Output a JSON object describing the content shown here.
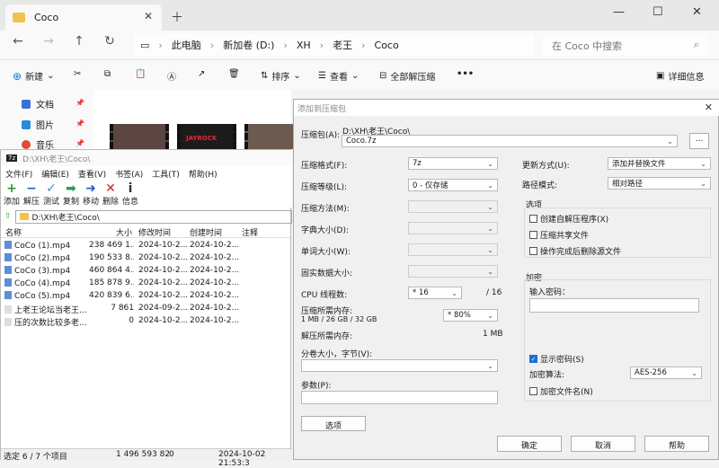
{
  "explorer": {
    "tab_title": "Coco",
    "breadcrumb": [
      "此电脑",
      "新加卷 (D:)",
      "XH",
      "老王",
      "Coco"
    ],
    "search_placeholder": "在 Coco 中搜索",
    "toolbar": {
      "new_label": "新建",
      "sort_label": "排序",
      "view_label": "查看",
      "extract_all_label": "全部解压缩",
      "more_label": "•••",
      "details_label": "详细信息"
    },
    "sidebar": [
      {
        "label": "文档",
        "color": "#3b6fd6"
      },
      {
        "label": "图片",
        "color": "#2a8bd8"
      },
      {
        "label": "音乐",
        "color": "#e24a3b"
      }
    ],
    "thumb_text": "JAYROCK"
  },
  "fm": {
    "title": "D:\\XH\\老王\\Coco\\",
    "menu": [
      "文件(F)",
      "编辑(E)",
      "查看(V)",
      "书签(A)",
      "工具(T)",
      "帮助(H)"
    ],
    "tools": [
      {
        "icon": "+",
        "label": "添加",
        "color": "#2e9a2e"
      },
      {
        "icon": "−",
        "label": "解压",
        "color": "#2a5bd6"
      },
      {
        "icon": "✓",
        "label": "测试",
        "color": "#2aa0b8"
      },
      {
        "icon": "➡",
        "label": "复制",
        "color": "#2e9a5a"
      },
      {
        "icon": "➜",
        "label": "移动",
        "color": "#2a5bd6"
      },
      {
        "icon": "✕",
        "label": "删除",
        "color": "#d62020"
      },
      {
        "icon": "i",
        "label": "信息",
        "color": "#333"
      }
    ],
    "path": "D:\\XH\\老王\\Coco\\",
    "columns": {
      "name": "名称",
      "size": "大小",
      "modified": "修改时间",
      "created": "创建时间",
      "comment": "注释"
    },
    "rows": [
      {
        "name": "CoCo (1).mp4",
        "size": "238 469 1...",
        "modified": "2024-10-2...",
        "created": "2024-10-2..."
      },
      {
        "name": "CoCo (2).mp4",
        "size": "190 533 8...",
        "modified": "2024-10-2...",
        "created": "2024-10-2..."
      },
      {
        "name": "CoCo (3).mp4",
        "size": "460 864 4...",
        "modified": "2024-10-2...",
        "created": "2024-10-2..."
      },
      {
        "name": "CoCo (4).mp4",
        "size": "185 878 9...",
        "modified": "2024-10-2...",
        "created": "2024-10-2..."
      },
      {
        "name": "CoCo (5).mp4",
        "size": "420 839 6...",
        "modified": "2024-10-2...",
        "created": "2024-10-2..."
      },
      {
        "name": "上老王论坛当老王...",
        "size": "7 861",
        "modified": "2024-09-2...",
        "created": "2024-10-2..."
      },
      {
        "name": "压的次数比较多老...",
        "size": "0",
        "modified": "2024-10-2...",
        "created": "2024-10-2..."
      }
    ],
    "status": {
      "selected": "选定 6 / 7 个项目",
      "total": "1 496 593 82",
      "zero": "0",
      "date": "2024-10-02 21:53:3"
    }
  },
  "dialog": {
    "title": "添加到压缩包",
    "archive_label": "压缩包(A):",
    "archive_dir": "D:\\XH\\老王\\Coco\\",
    "archive_name": "Coco.7z",
    "browse": "...",
    "format_label": "压缩格式(F):",
    "format_value": "7z",
    "level_label": "压缩等级(L):",
    "level_value": "0 - 仅存储",
    "method_label": "压缩方法(M):",
    "dict_label": "字典大小(D):",
    "word_label": "单词大小(W):",
    "solid_label": "固实数据大小:",
    "threads_label": "CPU 线程数:",
    "threads_value": "* 16",
    "threads_max": "/ 16",
    "mem_label": "压缩所需内存:",
    "mem_detail": "1 MB / 26 GB / 32 GB",
    "mem_value": "* 80%",
    "dmem_label": "解压所需内存:",
    "dmem_value": "1 MB",
    "volume_label": "分卷大小，字节(V):",
    "params_label": "参数(P):",
    "options_btn": "选项",
    "update_label": "更新方式(U):",
    "update_value": "添加并替换文件",
    "pathmode_label": "路径模式:",
    "pathmode_value": "相对路径",
    "options_group": "选项",
    "opt_sfx": "创建自解压程序(X)",
    "opt_shared": "压缩共享文件",
    "opt_delete": "操作完成后删除源文件",
    "encrypt_group": "加密",
    "password_label": "输入密码：",
    "show_password": "显示密码(S)",
    "enc_method_label": "加密算法:",
    "enc_method_value": "AES-256",
    "encrypt_names": "加密文件名(N)",
    "ok": "确定",
    "cancel": "取消",
    "help": "帮助"
  }
}
